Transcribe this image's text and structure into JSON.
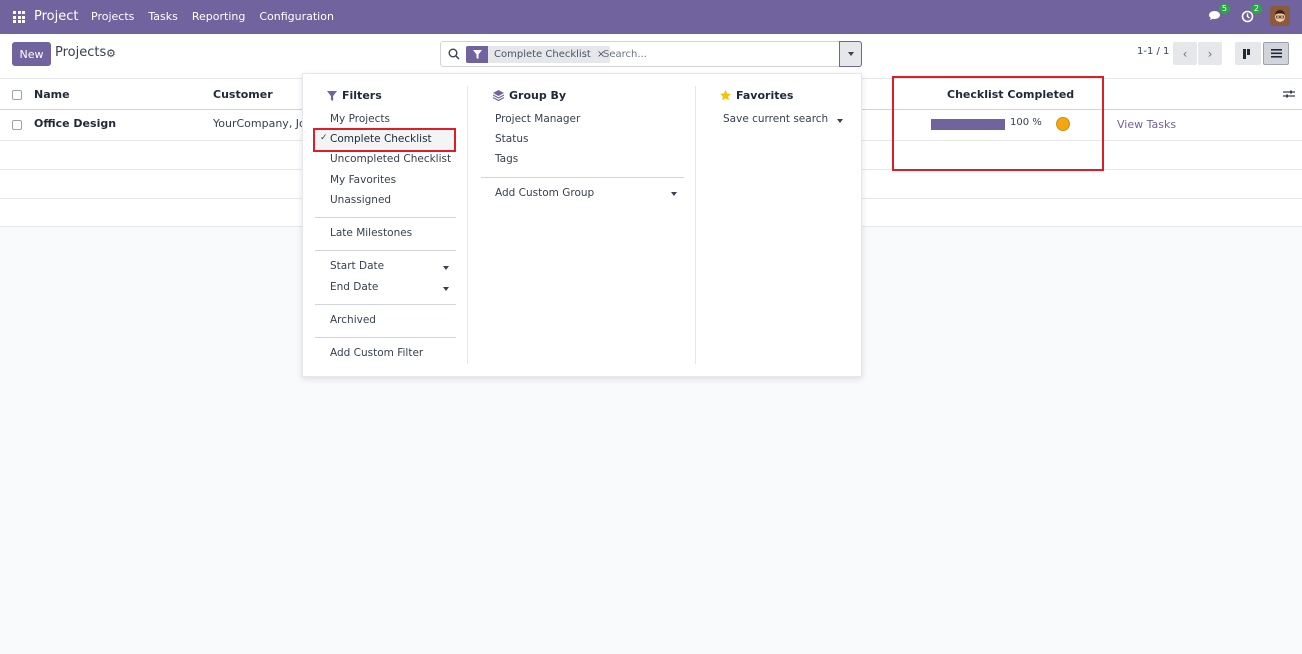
{
  "topbar": {
    "app_name": "Project",
    "nav": [
      "Projects",
      "Tasks",
      "Reporting",
      "Configuration"
    ],
    "messages_count": "5",
    "activity_count": "2"
  },
  "control": {
    "new_label": "New",
    "title": "Projects",
    "facet_label": "Complete Checklist",
    "facet_remove": "×",
    "search_placeholder": "Search...",
    "pager": "1-1 / 1",
    "prev": "‹",
    "next": "›"
  },
  "table": {
    "headers": {
      "name": "Name",
      "customer": "Customer",
      "checklist": "Checklist Completed"
    },
    "rows": [
      {
        "name": "Office Design",
        "customer": "YourCompany, Joe",
        "progress_label": "100 %",
        "progress_value": 100,
        "action": "View Tasks"
      }
    ]
  },
  "filters": {
    "title": "Filters",
    "items": [
      "My Projects",
      "Complete Checklist",
      "Uncompleted Checklist",
      "My Favorites",
      "Unassigned"
    ],
    "checkmark": "✓",
    "late": "Late Milestones",
    "start_date": "Start Date",
    "end_date": "End Date",
    "archived": "Archived",
    "add_custom": "Add Custom Filter"
  },
  "groupby": {
    "title": "Group By",
    "items": [
      "Project Manager",
      "Status",
      "Tags"
    ],
    "add_custom": "Add Custom Group"
  },
  "favorites": {
    "title": "Favorites",
    "save_search": "Save current search"
  },
  "colors": {
    "brand": "#71639e",
    "highlight": "#dc1f26",
    "status_dot": "#f3a712"
  }
}
